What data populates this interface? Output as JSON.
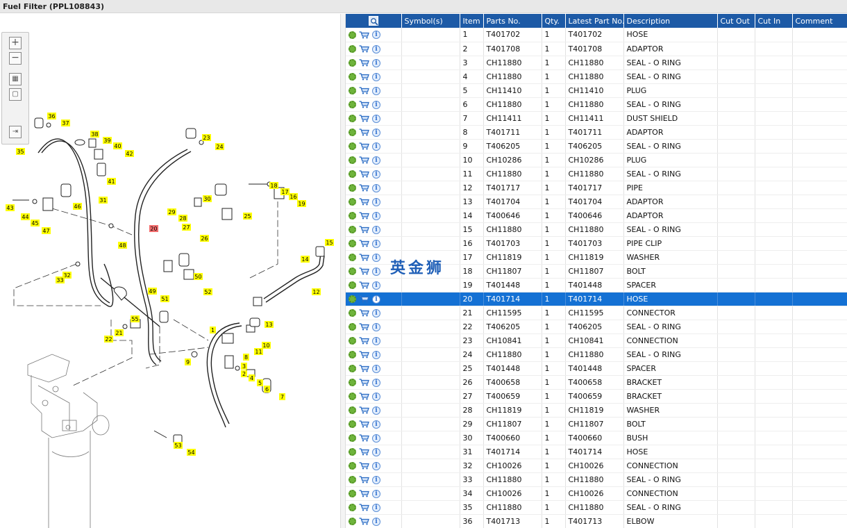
{
  "window": {
    "title": "Fuel Filter (PPL108843)"
  },
  "watermark": "英金狮",
  "colors": {
    "header": "#1d5aa6",
    "selected_row": "#1471d4",
    "callout_yellow": "#ffff00",
    "callout_red": "#f26d6d"
  },
  "zoom_toolbar": {
    "icons": [
      "zoom-in-icon",
      "zoom-out-icon",
      "fit-all-icon",
      "fit-window-icon",
      "export-icon"
    ]
  },
  "table": {
    "columns": [
      "",
      "Symbol(s)",
      "Item",
      "Parts No.",
      "Qty.",
      "Latest Part No.",
      "Description",
      "Cut Out",
      "Cut In",
      "Comment"
    ],
    "selected_item": "20",
    "rows": [
      {
        "item": "1",
        "part": "T401702",
        "qty": "1",
        "latest": "T401702",
        "desc": "HOSE"
      },
      {
        "item": "2",
        "part": "T401708",
        "qty": "1",
        "latest": "T401708",
        "desc": "ADAPTOR"
      },
      {
        "item": "3",
        "part": "CH11880",
        "qty": "1",
        "latest": "CH11880",
        "desc": "SEAL - O RING"
      },
      {
        "item": "4",
        "part": "CH11880",
        "qty": "1",
        "latest": "CH11880",
        "desc": "SEAL - O RING"
      },
      {
        "item": "5",
        "part": "CH11410",
        "qty": "1",
        "latest": "CH11410",
        "desc": "PLUG"
      },
      {
        "item": "6",
        "part": "CH11880",
        "qty": "1",
        "latest": "CH11880",
        "desc": "SEAL - O RING"
      },
      {
        "item": "7",
        "part": "CH11411",
        "qty": "1",
        "latest": "CH11411",
        "desc": "DUST SHIELD"
      },
      {
        "item": "8",
        "part": "T401711",
        "qty": "1",
        "latest": "T401711",
        "desc": "ADAPTOR"
      },
      {
        "item": "9",
        "part": "T406205",
        "qty": "1",
        "latest": "T406205",
        "desc": "SEAL - O RING"
      },
      {
        "item": "10",
        "part": "CH10286",
        "qty": "1",
        "latest": "CH10286",
        "desc": "PLUG"
      },
      {
        "item": "11",
        "part": "CH11880",
        "qty": "1",
        "latest": "CH11880",
        "desc": "SEAL - O RING"
      },
      {
        "item": "12",
        "part": "T401717",
        "qty": "1",
        "latest": "T401717",
        "desc": "PIPE"
      },
      {
        "item": "13",
        "part": "T401704",
        "qty": "1",
        "latest": "T401704",
        "desc": "ADAPTOR"
      },
      {
        "item": "14",
        "part": "T400646",
        "qty": "1",
        "latest": "T400646",
        "desc": "ADAPTOR"
      },
      {
        "item": "15",
        "part": "CH11880",
        "qty": "1",
        "latest": "CH11880",
        "desc": "SEAL - O RING"
      },
      {
        "item": "16",
        "part": "T401703",
        "qty": "1",
        "latest": "T401703",
        "desc": "PIPE CLIP"
      },
      {
        "item": "17",
        "part": "CH11819",
        "qty": "1",
        "latest": "CH11819",
        "desc": "WASHER"
      },
      {
        "item": "18",
        "part": "CH11807",
        "qty": "1",
        "latest": "CH11807",
        "desc": "BOLT"
      },
      {
        "item": "19",
        "part": "T401448",
        "qty": "1",
        "latest": "T401448",
        "desc": "SPACER"
      },
      {
        "item": "20",
        "part": "T401714",
        "qty": "1",
        "latest": "T401714",
        "desc": "HOSE"
      },
      {
        "item": "21",
        "part": "CH11595",
        "qty": "1",
        "latest": "CH11595",
        "desc": "CONNECTOR"
      },
      {
        "item": "22",
        "part": "T406205",
        "qty": "1",
        "latest": "T406205",
        "desc": "SEAL - O RING"
      },
      {
        "item": "23",
        "part": "CH10841",
        "qty": "1",
        "latest": "CH10841",
        "desc": "CONNECTION"
      },
      {
        "item": "24",
        "part": "CH11880",
        "qty": "1",
        "latest": "CH11880",
        "desc": "SEAL - O RING"
      },
      {
        "item": "25",
        "part": "T401448",
        "qty": "1",
        "latest": "T401448",
        "desc": "SPACER"
      },
      {
        "item": "26",
        "part": "T400658",
        "qty": "1",
        "latest": "T400658",
        "desc": "BRACKET"
      },
      {
        "item": "27",
        "part": "T400659",
        "qty": "1",
        "latest": "T400659",
        "desc": "BRACKET"
      },
      {
        "item": "28",
        "part": "CH11819",
        "qty": "1",
        "latest": "CH11819",
        "desc": "WASHER"
      },
      {
        "item": "29",
        "part": "CH11807",
        "qty": "1",
        "latest": "CH11807",
        "desc": "BOLT"
      },
      {
        "item": "30",
        "part": "T400660",
        "qty": "1",
        "latest": "T400660",
        "desc": "BUSH"
      },
      {
        "item": "31",
        "part": "T401714",
        "qty": "1",
        "latest": "T401714",
        "desc": "HOSE"
      },
      {
        "item": "32",
        "part": "CH10026",
        "qty": "1",
        "latest": "CH10026",
        "desc": "CONNECTION"
      },
      {
        "item": "33",
        "part": "CH11880",
        "qty": "1",
        "latest": "CH11880",
        "desc": "SEAL - O RING"
      },
      {
        "item": "34",
        "part": "CH10026",
        "qty": "1",
        "latest": "CH10026",
        "desc": "CONNECTION"
      },
      {
        "item": "35",
        "part": "CH11880",
        "qty": "1",
        "latest": "CH11880",
        "desc": "SEAL - O RING"
      },
      {
        "item": "36",
        "part": "T401713",
        "qty": "1",
        "latest": "T401713",
        "desc": "ELBOW"
      }
    ]
  },
  "callouts": [
    "1",
    "2",
    "3",
    "4",
    "5",
    "6",
    "7",
    "8",
    "9",
    "10",
    "11",
    "12",
    "13",
    "14",
    "15",
    "16",
    "17",
    "18",
    "19",
    "20",
    "21",
    "22",
    "23",
    "24",
    "25",
    "26",
    "27",
    "28",
    "29",
    "30",
    "31",
    "32",
    "33",
    "35",
    "36",
    "37",
    "38",
    "39",
    "40",
    "41",
    "42",
    "43",
    "44",
    "45",
    "46",
    "47",
    "48",
    "49",
    "50",
    "51",
    "52",
    "53",
    "54",
    "55"
  ]
}
